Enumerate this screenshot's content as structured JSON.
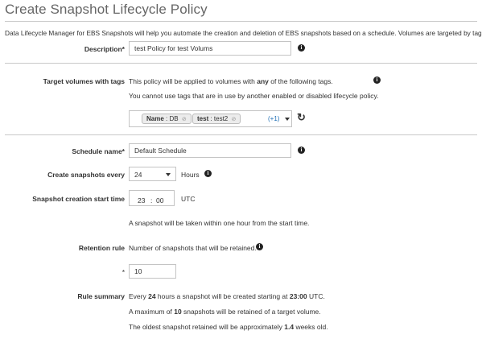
{
  "page": {
    "title": "Create Snapshot Lifecycle Policy",
    "intro": "Data Lifecycle Manager for EBS Snapshots will help you automate the creation and deletion of EBS snapshots based on a schedule. Volumes are targeted by tags"
  },
  "description": {
    "label": "Description*",
    "value": "test Policy for test Volums"
  },
  "target": {
    "label": "Target volumes with tags",
    "line1_pre": "This policy will be applied to volumes with ",
    "line1_bold": "any",
    "line1_post": " of the following tags.",
    "line2": "You cannot use tags that are in use by another enabled or disabled lifecycle policy.",
    "tags": [
      {
        "key": "Name",
        "value": "DB"
      },
      {
        "key": "test",
        "value": "test2"
      }
    ],
    "more": "(+1)"
  },
  "schedule": {
    "name_label": "Schedule name*",
    "name_value": "Default Schedule",
    "every_label": "Create snapshots every",
    "every_value": "24",
    "every_unit": "Hours",
    "start_label": "Snapshot creation start time",
    "start_hour": "23",
    "start_sep": ":",
    "start_min": "00",
    "start_tz": "UTC",
    "start_note": "A snapshot will be taken within one hour from the start time."
  },
  "retention": {
    "label": "Retention rule",
    "desc": "Number of snapshots that will be retained.",
    "count_label": "*",
    "count_value": "10"
  },
  "summary": {
    "label": "Rule summary",
    "l1_a": "Every ",
    "l1_b": "24",
    "l1_c": " hours a snapshot will be created starting at ",
    "l1_d": "23:00",
    "l1_e": " UTC.",
    "l2_a": "A maximum of ",
    "l2_b": "10",
    "l2_c": " snapshots will be retained of a target volume.",
    "l3_a": "The oldest snapshot retained will be approximately ",
    "l3_b": "1.4",
    "l3_c": " weeks old."
  },
  "icons": {
    "info": "i",
    "refresh": "↻",
    "chip_remove": "⊘"
  }
}
